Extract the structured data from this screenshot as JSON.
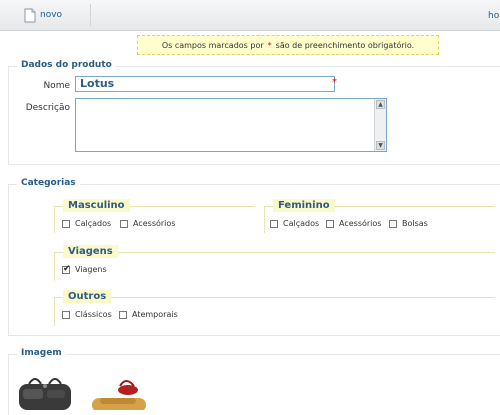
{
  "toolbar": {
    "new_label": "novo",
    "right_label": "ho"
  },
  "notice": {
    "before": "Os campos marcados por",
    "star": "*",
    "after": "são de preenchimento obrigatório."
  },
  "produto": {
    "legend": "Dados do produto",
    "nome_label": "Nome",
    "nome_value": "Lotus",
    "required_mark": "*",
    "descricao_label": "Descrição"
  },
  "categorias": {
    "legend": "Categorias",
    "groups": [
      {
        "title": "Masculino",
        "items": [
          {
            "label": "Calçados",
            "checked": false
          },
          {
            "label": "Acessórios",
            "checked": false
          }
        ]
      },
      {
        "title": "Feminino",
        "items": [
          {
            "label": "Calçados",
            "checked": false
          },
          {
            "label": "Acessórios",
            "checked": false
          },
          {
            "label": "Bolsas",
            "checked": false
          }
        ]
      },
      {
        "title": "Viagens",
        "items": [
          {
            "label": "Viagens",
            "checked": true
          }
        ]
      },
      {
        "title": "Outros",
        "items": [
          {
            "label": "Clássicos",
            "checked": false
          },
          {
            "label": "Atemporais",
            "checked": false
          }
        ]
      }
    ]
  },
  "imagem": {
    "legend": "Imagem"
  },
  "colors": {
    "accent": "#2a5d8a",
    "required": "#dd0000",
    "group_bg": "#fdf8c8"
  }
}
